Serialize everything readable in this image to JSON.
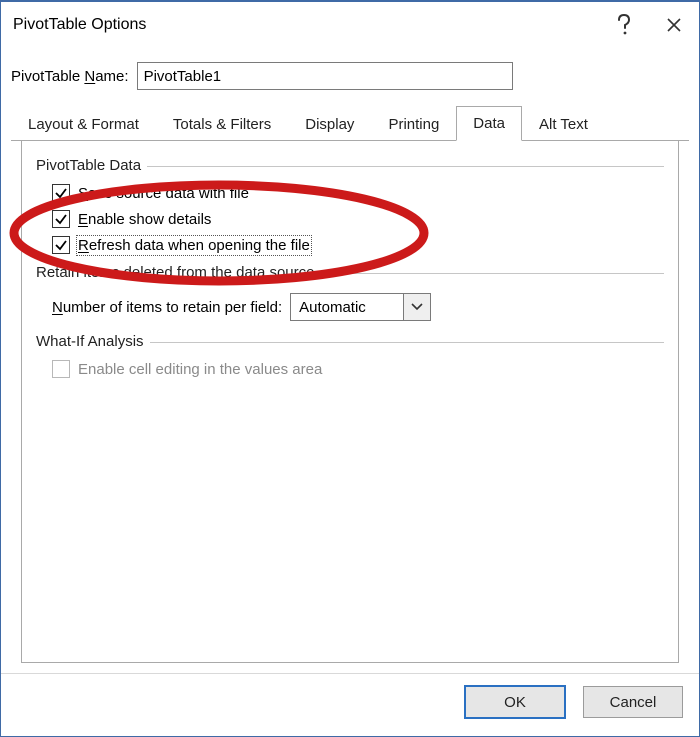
{
  "titlebar": {
    "title": "PivotTable Options"
  },
  "name": {
    "label_pre": "PivotTable ",
    "label_accel": "N",
    "label_post": "ame:",
    "value": "PivotTable1"
  },
  "tabs": [
    {
      "label": "Layout & Format"
    },
    {
      "label": "Totals & Filters"
    },
    {
      "label": "Display"
    },
    {
      "label": "Printing"
    },
    {
      "label": "Data"
    },
    {
      "label": "Alt Text"
    }
  ],
  "active_tab": "Data",
  "groups": {
    "data": {
      "title": "PivotTable Data",
      "opt_save": {
        "accel": "S",
        "rest": "ave source data with file",
        "checked": true
      },
      "opt_details": {
        "accel": "E",
        "rest": "nable show details",
        "checked": true
      },
      "opt_refresh": {
        "accel": "R",
        "rest": "efresh data when opening the file",
        "checked": true,
        "focused": true
      }
    },
    "retain": {
      "title": "Retain items deleted from the data source",
      "label_accel": "N",
      "label_rest": "umber of items to retain per field:",
      "value": "Automatic"
    },
    "whatif": {
      "title": "What-If Analysis",
      "opt_edit": {
        "label": "Enable cell editing in the values area",
        "checked": false,
        "enabled": false
      }
    }
  },
  "buttons": {
    "ok": "OK",
    "cancel": "Cancel"
  }
}
